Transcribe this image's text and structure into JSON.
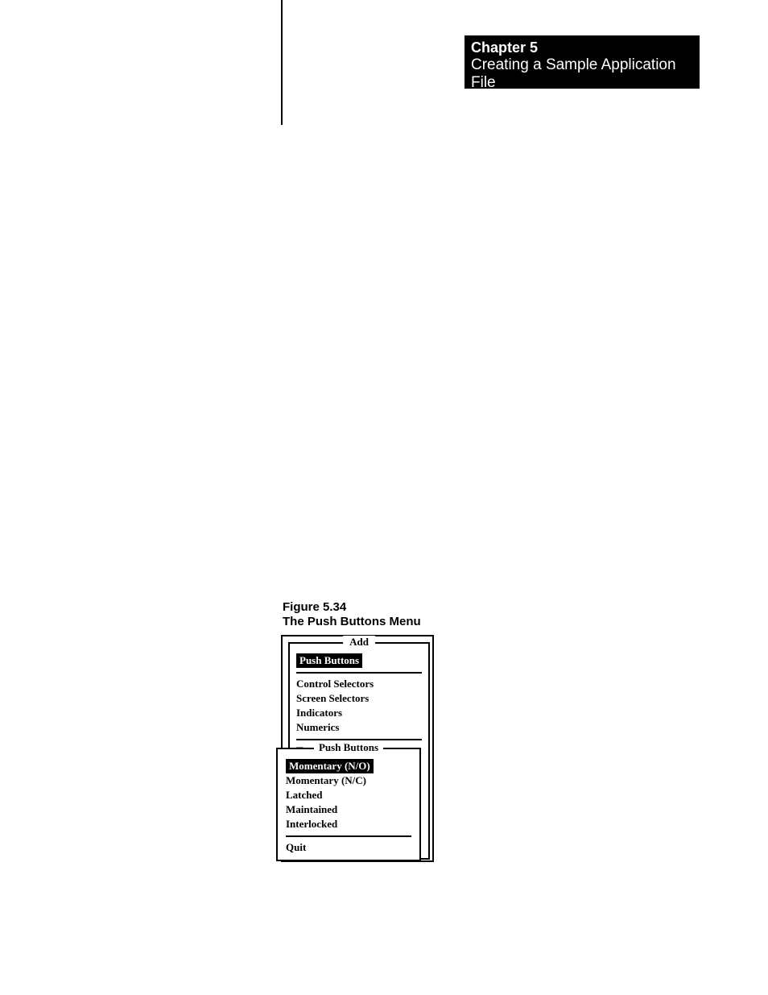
{
  "header": {
    "chapter": "Chapter 5",
    "title": "Creating a Sample Application File"
  },
  "figure": {
    "number": "Figure 5.34",
    "title": "The Push Buttons Menu"
  },
  "add_menu": {
    "title": "Add",
    "selected": "Push Buttons",
    "items_group1": [
      "Control Selectors",
      "Screen  Selectors",
      "Indicators",
      "Numerics"
    ],
    "items_group2": [
      "Text/Draw"
    ]
  },
  "push_buttons_menu": {
    "title": "Push Buttons",
    "selected": "Momentary (N/O)",
    "items": [
      "Momentary (N/C)",
      "Latched",
      "Maintained",
      "Interlocked"
    ],
    "quit": "Quit"
  }
}
